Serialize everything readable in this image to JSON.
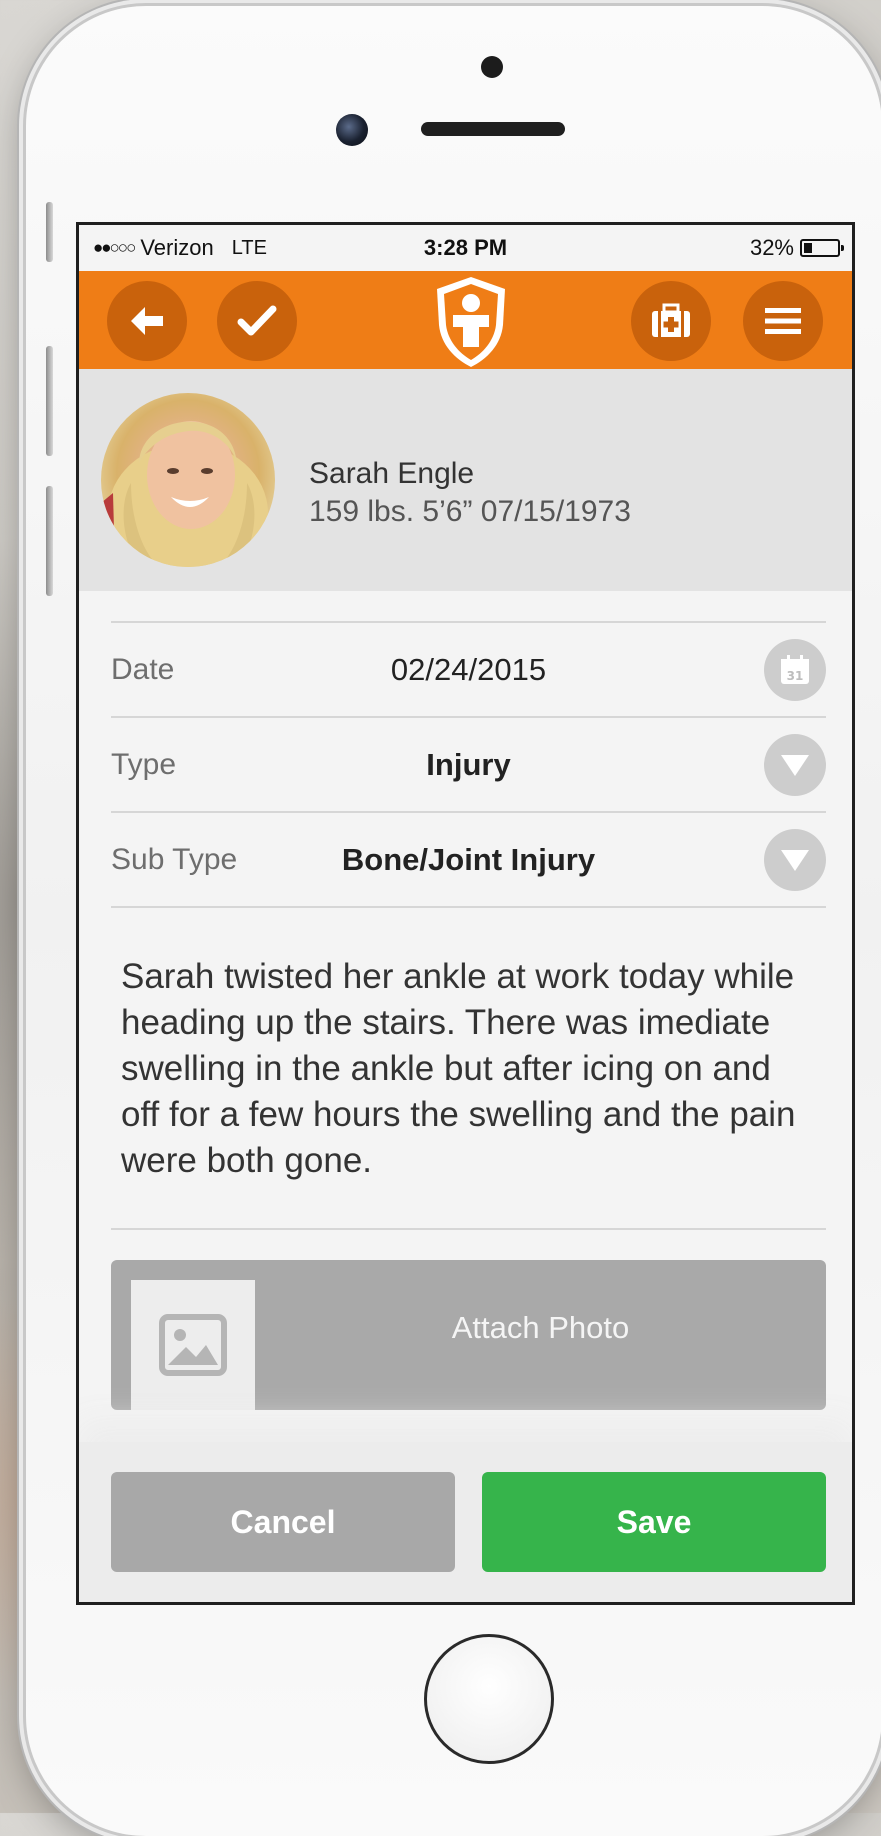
{
  "status_bar": {
    "signal": "●●○○○",
    "carrier": "Verizon",
    "network": "LTE",
    "time": "3:28 PM",
    "battery_percent": "32%",
    "battery_level": 0.32
  },
  "navbar": {
    "back_icon": "arrow-left-icon",
    "confirm_icon": "checkmark-icon",
    "logo_icon": "medical-shield-logo-icon",
    "first_aid_icon": "first-aid-kit-icon",
    "menu_icon": "hamburger-menu-icon",
    "accent_color": "#ef7d16"
  },
  "profile": {
    "name": "Sarah Engle",
    "stats": "159 lbs. 5’6” 07/15/1973"
  },
  "form": {
    "date_label": "Date",
    "date_value": "02/24/2015",
    "date_icon_day": "31",
    "type_label": "Type",
    "type_value": "Injury",
    "subtype_label": "Sub Type",
    "subtype_value": "Bone/Joint Injury",
    "notes": "Sarah twisted her ankle at work today while heading up the stairs. There was imediate swelling in the ankle but after icing on and off for a few hours the swelling and the pain were both gone."
  },
  "attach": {
    "label": "Attach Photo",
    "icon": "image-icon"
  },
  "footer": {
    "cancel_label": "Cancel",
    "save_label": "Save",
    "save_color": "#36b44b",
    "cancel_color": "#a8a8a8"
  }
}
